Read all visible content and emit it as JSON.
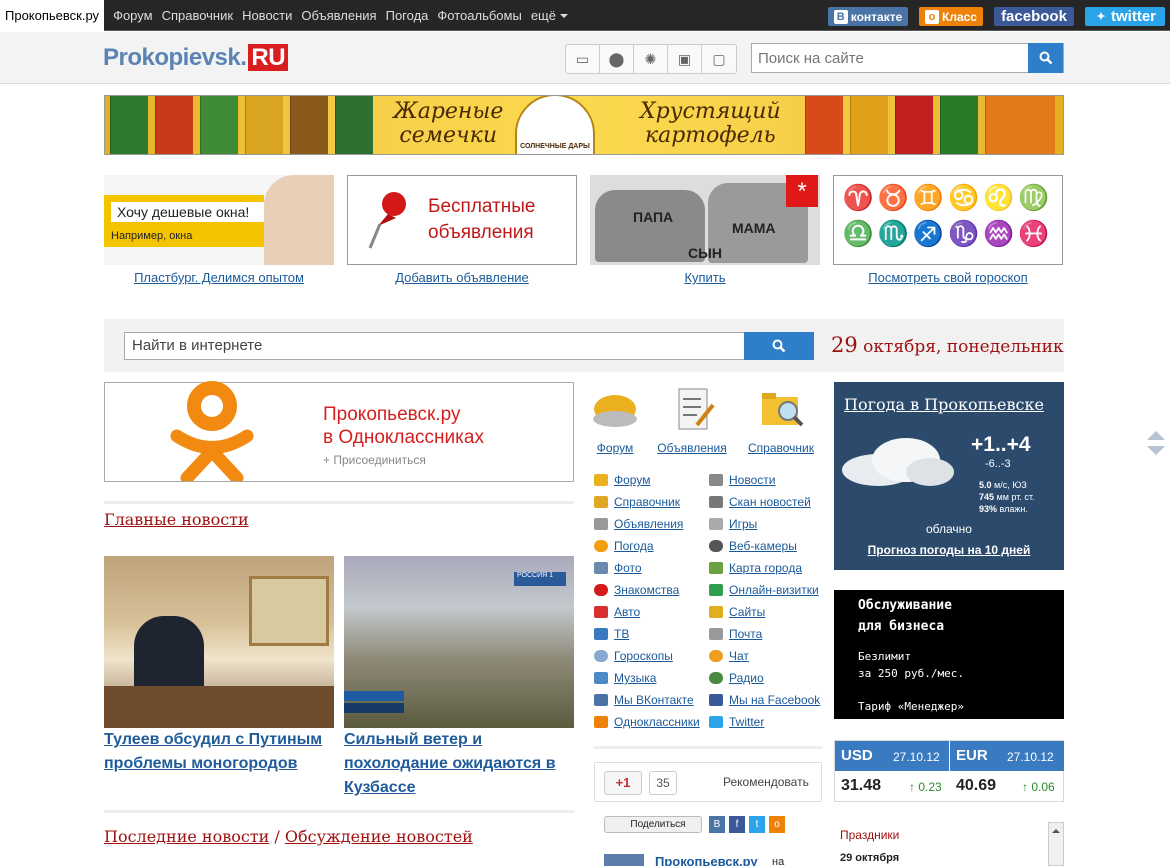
{
  "topbar": {
    "site": "Прокопьевск.ру",
    "nav": [
      "Форум",
      "Справочник",
      "Новости",
      "Объявления",
      "Погода",
      "Фотоальбомы",
      "ещё"
    ],
    "social": {
      "vk": "контакте",
      "ok": "Класс",
      "fb": "facebook",
      "tw": "twitter"
    }
  },
  "header": {
    "logo_main": "Prokopievsk.",
    "logo_ru": "RU",
    "search_placeholder": "Поиск на сайте"
  },
  "banner": {
    "line1a": "Жареные",
    "line1b": "семечки",
    "line2a": "Хрустящий",
    "line2b": "картофель",
    "brand": "СОЛНЕЧНЫЕ ДАРЫ"
  },
  "ads": [
    {
      "text": "Хочу дешевые окна!",
      "sub": "Например, окна",
      "link": "Пластбург. Делимся опытом"
    },
    {
      "text": "Бесплатные объявления",
      "link": "Добавить объявление"
    },
    {
      "text1": "ПАПА",
      "text2": "МАМА",
      "text3": "СЫН",
      "link": "Купить"
    },
    {
      "link": "Посмотреть свой гороскоп"
    }
  ],
  "websearch": {
    "placeholder": "Найти в интернете",
    "date_day": "29",
    "date_rest": " октября, понедельник"
  },
  "ok_banner": {
    "line1": "Прокопьевск.ру",
    "line2": "в Одноклассниках",
    "join": "+ Присоединиться"
  },
  "main_news": {
    "title": "Главные новости",
    "items": [
      {
        "title": "Тулеев обсудил с Путиным проблемы моногородов"
      },
      {
        "title": "Сильный ветер и похолодание ожидаются в Кузбассе"
      }
    ]
  },
  "last_news": {
    "title_a": "Последние новости",
    "sep": " / ",
    "title_b": "Обсуждение новостей"
  },
  "big_icons": [
    "Форум",
    "Объявления",
    "Справочник"
  ],
  "list_left": [
    "Форум",
    "Справочник",
    "Объявления",
    "Погода",
    "Фото",
    "Знакомства",
    "Авто",
    "ТВ",
    "Гороскопы",
    "Музыка",
    "Мы ВКонтакте",
    "Одноклассники"
  ],
  "list_right": [
    "Новости",
    "Скан новостей",
    "Игры",
    "Веб-камеры",
    "Карта города",
    "Онлайн-визитки",
    "Сайты",
    "Почта",
    "Чат",
    "Радио",
    "Мы на Facebook",
    "Twitter"
  ],
  "recommend": {
    "plus": "+1",
    "count": "35",
    "label": "Рекомендовать"
  },
  "share": {
    "label": "Поделиться"
  },
  "weather": {
    "title": "Погода в Прокопьевске",
    "temp": "+1..+4",
    "night": "-6..-3",
    "wind": "5.0",
    "wind_unit": "м/с, ЮЗ",
    "pressure": "745",
    "pressure_unit": "мм рт. ст.",
    "humidity": "93%",
    "humidity_unit": "влажн.",
    "cond": "облачно",
    "forecast": "Прогноз погоды на 10 дней"
  },
  "biz": {
    "l1": "Обслуживание",
    "l2": "для бизнеса",
    "l3": "Безлимит",
    "l4": "за 250 руб./мес.",
    "l5": "Тариф «Менеджер»"
  },
  "currency": {
    "usd": "USD",
    "usd_date": "27.10.12",
    "usd_val": "31.48",
    "usd_ch": "0.23",
    "eur": "EUR",
    "eur_date": "27.10.12",
    "eur_val": "40.69",
    "eur_ch": "0.06"
  },
  "holidays": {
    "title": "Праздники",
    "date": "29 октября"
  },
  "bottom_promo": {
    "name": "Прокопьевск.ру",
    "suffix": "на"
  },
  "colors": {
    "accent": "#2f7ec9",
    "red": "#a01010",
    "link": "#1a5a9a"
  }
}
